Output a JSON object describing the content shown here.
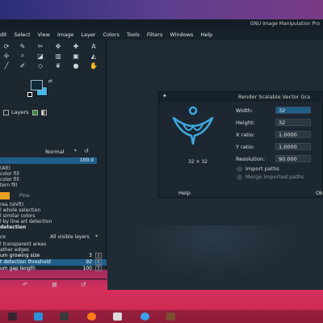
{
  "window": {
    "title": "GNU Image Manipulation Pro"
  },
  "menubar": {
    "items": [
      "dit",
      "Select",
      "View",
      "Image",
      "Layer",
      "Colors",
      "Tools",
      "Filters",
      "Windows",
      "Help"
    ]
  },
  "left_dock": {
    "tabs": [
      "Layers"
    ],
    "mode": "Normal",
    "opacity_value": "100.0",
    "fill_options": [
      "(Alt)",
      "color fill",
      "color fill",
      "tern fill"
    ],
    "pattern_name": "Pine",
    "affected_area": [
      "rea  (shift)",
      "l whole selection",
      "l similar colors",
      "l by line art detection"
    ],
    "line_art_heading": "detection",
    "source_label": "ce",
    "source_value": "All visible layers",
    "bottom_options": [
      "l transparent areas",
      "ather edges"
    ],
    "sliders": [
      {
        "label": "um growing size",
        "value": "3",
        "highlight": false
      },
      {
        "label": "t detection threshold",
        "value": "92",
        "highlight": true
      },
      {
        "label": "um gap length",
        "value": "100",
        "highlight": false
      }
    ]
  },
  "dialog": {
    "title": "Render Scalable Vector Gra",
    "preview_size": "32 × 32",
    "width_label": "Width:",
    "width_value": "32",
    "height_label": "Height:",
    "height_value": "32",
    "xratio_label": "X ratio:",
    "xratio_value": "1.0000",
    "yratio_label": "Y ratio:",
    "yratio_value": "1.0000",
    "resolution_label": "Resolution:",
    "resolution_value": "90.000",
    "import_paths": "Import paths",
    "merge_paths": "Merge imported paths",
    "help_button": "Help",
    "ok_button": "Ok",
    "icon_color": "#3ea8e0"
  }
}
